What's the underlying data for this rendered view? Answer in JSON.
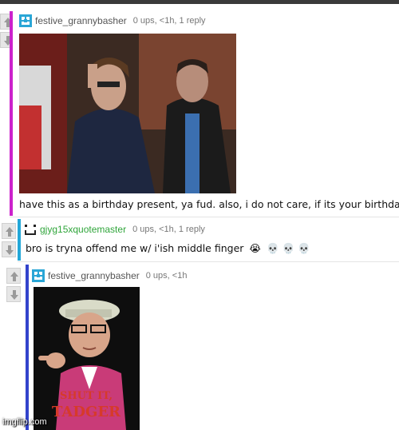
{
  "comments": [
    {
      "username": "festive_grannybasher",
      "meta": "0 ups, <1h, 1 reply",
      "text": "have this as a birthday present, ya fud. also, i do not care, if its your birthday.",
      "bar_color": "#cc22cc",
      "username_color": "#555555",
      "image": {
        "kind": "photo"
      }
    },
    {
      "username": "gjyg15xquotemaster",
      "meta": "0 ups, <1h, 1 reply",
      "text": "bro is tryna offend me w/ i'ish middle finger",
      "emojis": [
        "😭",
        "💀",
        "💀",
        "💀"
      ],
      "bar_color": "#22a7d8",
      "username_color": "#2fa53a"
    },
    {
      "username": "festive_grannybasher",
      "meta": "0 ups, <1h",
      "bar_color": "#3344cc",
      "username_color": "#555555",
      "image": {
        "kind": "poster",
        "caption_line1": "SHUT IT,",
        "caption_line2": "TADGER"
      }
    }
  ],
  "watermark": "imgflip.com",
  "icons": {
    "upvote": "arrow-up-icon",
    "downvote": "arrow-down-icon",
    "avatar_1": "geometric-avatar-icon",
    "avatar_2": "pixel-face-avatar-icon"
  },
  "colors": {
    "accent_blue": "#2aa6d6",
    "vote_gray": "#9a9a9a"
  }
}
